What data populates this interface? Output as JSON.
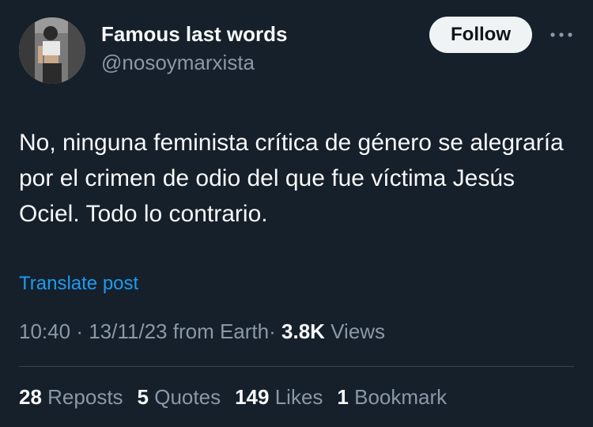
{
  "author": {
    "display_name": "Famous last words",
    "handle": "@nosoymarxista",
    "avatar_icon": "profile-photo"
  },
  "header": {
    "follow_label": "Follow",
    "more_icon": "more-horizontal-icon"
  },
  "tweet": {
    "text": "No, ninguna feminista crítica de género se alegraría por el crimen de odio del que fue víctima Jesús Ociel. Todo lo contrario.",
    "translate_label": "Translate post"
  },
  "meta": {
    "time": "10:40",
    "sep1": "·",
    "date": "13/11/23",
    "source": "from Earth",
    "sep2": "·",
    "views_count": "3.8K",
    "views_label": "Views"
  },
  "stats": {
    "reposts_count": "28",
    "reposts_label": "Reposts",
    "quotes_count": "5",
    "quotes_label": "Quotes",
    "likes_count": "149",
    "likes_label": "Likes",
    "bookmarks_count": "1",
    "bookmarks_label": "Bookmark"
  },
  "colors": {
    "background": "#15202b",
    "text_primary": "#f7f9f9",
    "text_secondary": "#8b98a5",
    "link": "#1d9bf0",
    "divider": "#38444d",
    "follow_bg": "#eff3f4"
  }
}
